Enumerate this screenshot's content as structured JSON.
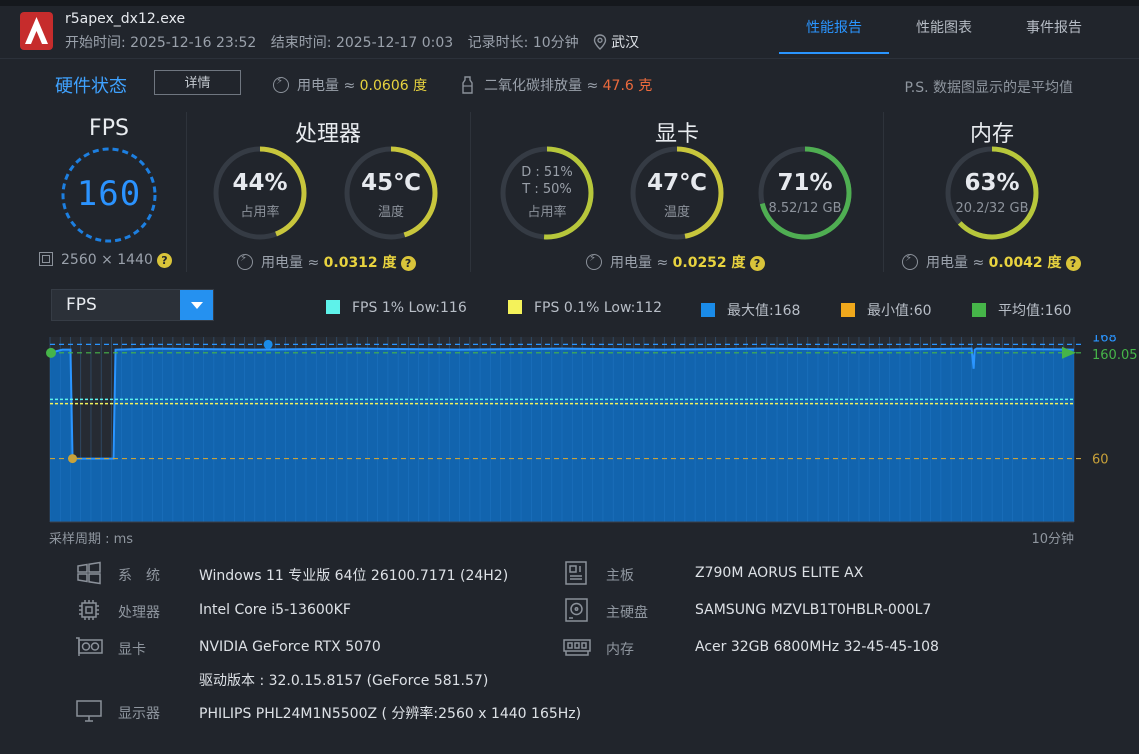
{
  "header": {
    "app_name": "r5apex_dx12.exe",
    "start": "开始时间: 2025-12-16 23:52",
    "end": "结束时间: 2025-12-17 0:03",
    "duration": "记录时长: 10分钟",
    "location": "武汉",
    "tabs": [
      "性能报告",
      "性能图表",
      "事件报告"
    ],
    "active_tab": 0
  },
  "hardware": {
    "title": "硬件状态",
    "detail_label": "详情",
    "power_label": "用电量 ≈",
    "power_value": "0.0606 度",
    "co2_label": "二氧化碳排放量 ≈",
    "co2_value": "47.6 克",
    "note": "P.S. 数据图显示的是平均值"
  },
  "fps": {
    "title": "FPS",
    "value": "160",
    "resolution": "2560 × 1440"
  },
  "cpu": {
    "title": "处理器",
    "usage_value": "44%",
    "usage_label": "占用率",
    "usage_fraction": 0.44,
    "temp_value": "45℃",
    "temp_label": "温度",
    "temp_fraction": 0.45,
    "power_label": "用电量 ≈",
    "power_value": "0.0312 度"
  },
  "gpu": {
    "title": "显卡",
    "usage_d": "D : 51%",
    "usage_t": "T : 50%",
    "usage_label": "占用率",
    "usage_fraction": 0.51,
    "temp_value": "47℃",
    "temp_label": "温度",
    "temp_fraction": 0.47,
    "vram_value": "71%",
    "vram_detail": "8.52/12 GB",
    "vram_fraction": 0.71,
    "power_label": "用电量 ≈",
    "power_value": "0.0252 度"
  },
  "memory": {
    "title": "内存",
    "usage_value": "63%",
    "usage_detail": "20.2/32 GB",
    "usage_fraction": 0.63,
    "power_label": "用电量 ≈",
    "power_value": "0.0042 度"
  },
  "chart_selector": {
    "value": "FPS"
  },
  "legend": [
    {
      "label": "FPS 1% Low:116",
      "color": "#5ef2ea"
    },
    {
      "label": "FPS 0.1% Low:112",
      "color": "#f4f25a"
    },
    {
      "label": "最大值:168",
      "color": "#1a8be8"
    },
    {
      "label": "最小值:60",
      "color": "#f0a81c"
    },
    {
      "label": "平均值:160",
      "color": "#46b549"
    }
  ],
  "chart_data": {
    "type": "area",
    "x_unit_label": "采样周期 : ms",
    "x_end_label": "10分钟",
    "ylim": [
      0,
      175
    ],
    "reference_lines": [
      {
        "label": "168",
        "value": 168,
        "color": "#2a95ff"
      },
      {
        "label": "160.05",
        "value": 160.05,
        "color": "#46b549"
      },
      {
        "label": "60",
        "value": 60,
        "color": "#c9a23a"
      }
    ],
    "low_lines": [
      {
        "value": 116,
        "color": "#5ef2ea"
      },
      {
        "value": 112,
        "color": "#f4f25a"
      }
    ],
    "x_fraction": [
      0.0,
      0.012,
      0.02,
      0.022,
      0.062,
      0.064,
      0.1,
      0.2,
      0.3,
      0.4,
      0.5,
      0.6,
      0.7,
      0.8,
      0.9,
      0.902,
      0.903,
      0.905,
      1.0
    ],
    "values": [
      160,
      163,
      163,
      60,
      60,
      163,
      164,
      163,
      164,
      163,
      164,
      163,
      164,
      163,
      164,
      145,
      163,
      164,
      163
    ],
    "max_point": {
      "x_fraction": 0.213,
      "value": 168
    },
    "min_point": {
      "x_fraction": 0.022,
      "value": 60
    },
    "avg_value": 160.05
  },
  "specs": {
    "system_label": "系　统",
    "system_value": "Windows 11 专业版 64位 26100.7171 (24H2)",
    "cpu_label": "处理器",
    "cpu_value": "Intel Core i5-13600KF",
    "gpu_label": "显卡",
    "gpu_value": "NVIDIA GeForce RTX 5070",
    "driver_value": "驱动版本 : 32.0.15.8157 (GeForce 581.57)",
    "monitor_label": "显示器",
    "monitor_value": "PHILIPS PHL24M1N5500Z ( 分辨率:2560 x 1440 165Hz)",
    "board_label": "主板",
    "board_value": "Z790M AORUS ELITE AX",
    "disk_label": "主硬盘",
    "disk_value": "SAMSUNG MZVLB1T0HBLR-000L7",
    "ram_label": "内存",
    "ram_value": "Acer 32GB 6800MHz 32-45-45-108"
  }
}
